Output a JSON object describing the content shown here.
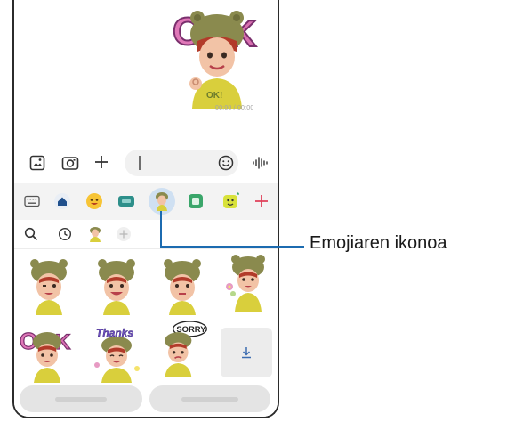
{
  "chat": {
    "sent_sticker_name": "emoji-ok-sticker",
    "timestamp": "00:00 / 00:00"
  },
  "composer": {
    "input_value": "",
    "input_placeholder": "",
    "icons": [
      "gallery-icon",
      "camera-icon",
      "plus-icon",
      "emoji-icon",
      "voice-icon"
    ]
  },
  "panel": {
    "tabs": [
      {
        "name": "keyboard-icon"
      },
      {
        "name": "home-icon"
      },
      {
        "name": "emoji-icon"
      },
      {
        "name": "gif-icon"
      },
      {
        "name": "ar-emoji-icon",
        "selected": true
      },
      {
        "name": "sticker-icon"
      },
      {
        "name": "bitmoji-icon"
      },
      {
        "name": "add-icon"
      }
    ],
    "sub_icons": [
      "search-icon",
      "recent-icon",
      "avatar-icon",
      "add-icon"
    ],
    "stickers": [
      "wink-sticker",
      "smile-sticker",
      "neutral-sticker",
      "flower-sticker",
      "ok-sticker",
      "thanks-sticker",
      "sorry-sticker"
    ],
    "download_icon": "download-icon",
    "pills": [
      {
        "label": "···· ········"
      },
      {
        "label": "······ ·······"
      }
    ]
  },
  "callout": {
    "label": "Emojiaren ikonoa"
  },
  "colors": {
    "accent": "#1c6bb0",
    "selected_tab_bg": "#cfe0f2",
    "panel_bg": "#f3f3f3",
    "sticker_shirt": "#d9cf3c",
    "sticker_hat": "#8a8a4e",
    "ok_letters": "#e078b8"
  }
}
